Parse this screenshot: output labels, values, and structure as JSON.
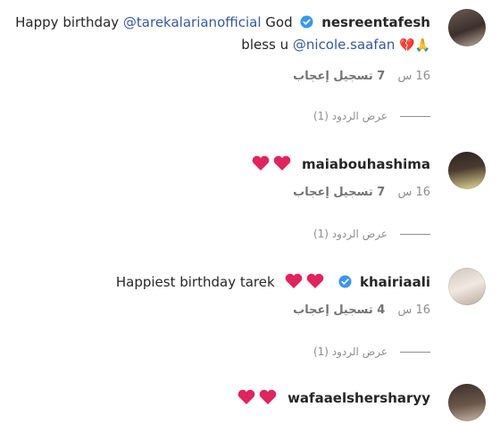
{
  "comments": [
    {
      "username": "nesreentafesh",
      "verified": true,
      "text_line1": "Happy birthday ",
      "mention1": "@tarekalarianofficial",
      "text_after1": " God",
      "text_line2_pre": "bless u ",
      "mention2": "@nicole.saafan",
      "emoji": "💔🙏",
      "time": "16 س",
      "likes": "7 تسجيل إعجاب",
      "replies": "عرض الردود (1)"
    },
    {
      "username": "maiabouhashima",
      "hearts": "❤️❤️",
      "time": "16 س",
      "likes": "7 تسجيل إعجاب",
      "replies": "عرض الردود (1)"
    },
    {
      "username": "khairiaali",
      "verified": true,
      "text": "Happiest birthday tarek",
      "hearts": "❤️❤️",
      "time": "16 س",
      "likes": "4 تسجيل إعجاب",
      "replies": "عرض الردود (1)"
    },
    {
      "username": "wafaaelshersharyy",
      "hearts": "❤️❤️"
    }
  ],
  "colors": {
    "mention": "#385898",
    "verified": "#3897f0",
    "heart": "#e0245e",
    "meta": "#8e8e8e"
  }
}
